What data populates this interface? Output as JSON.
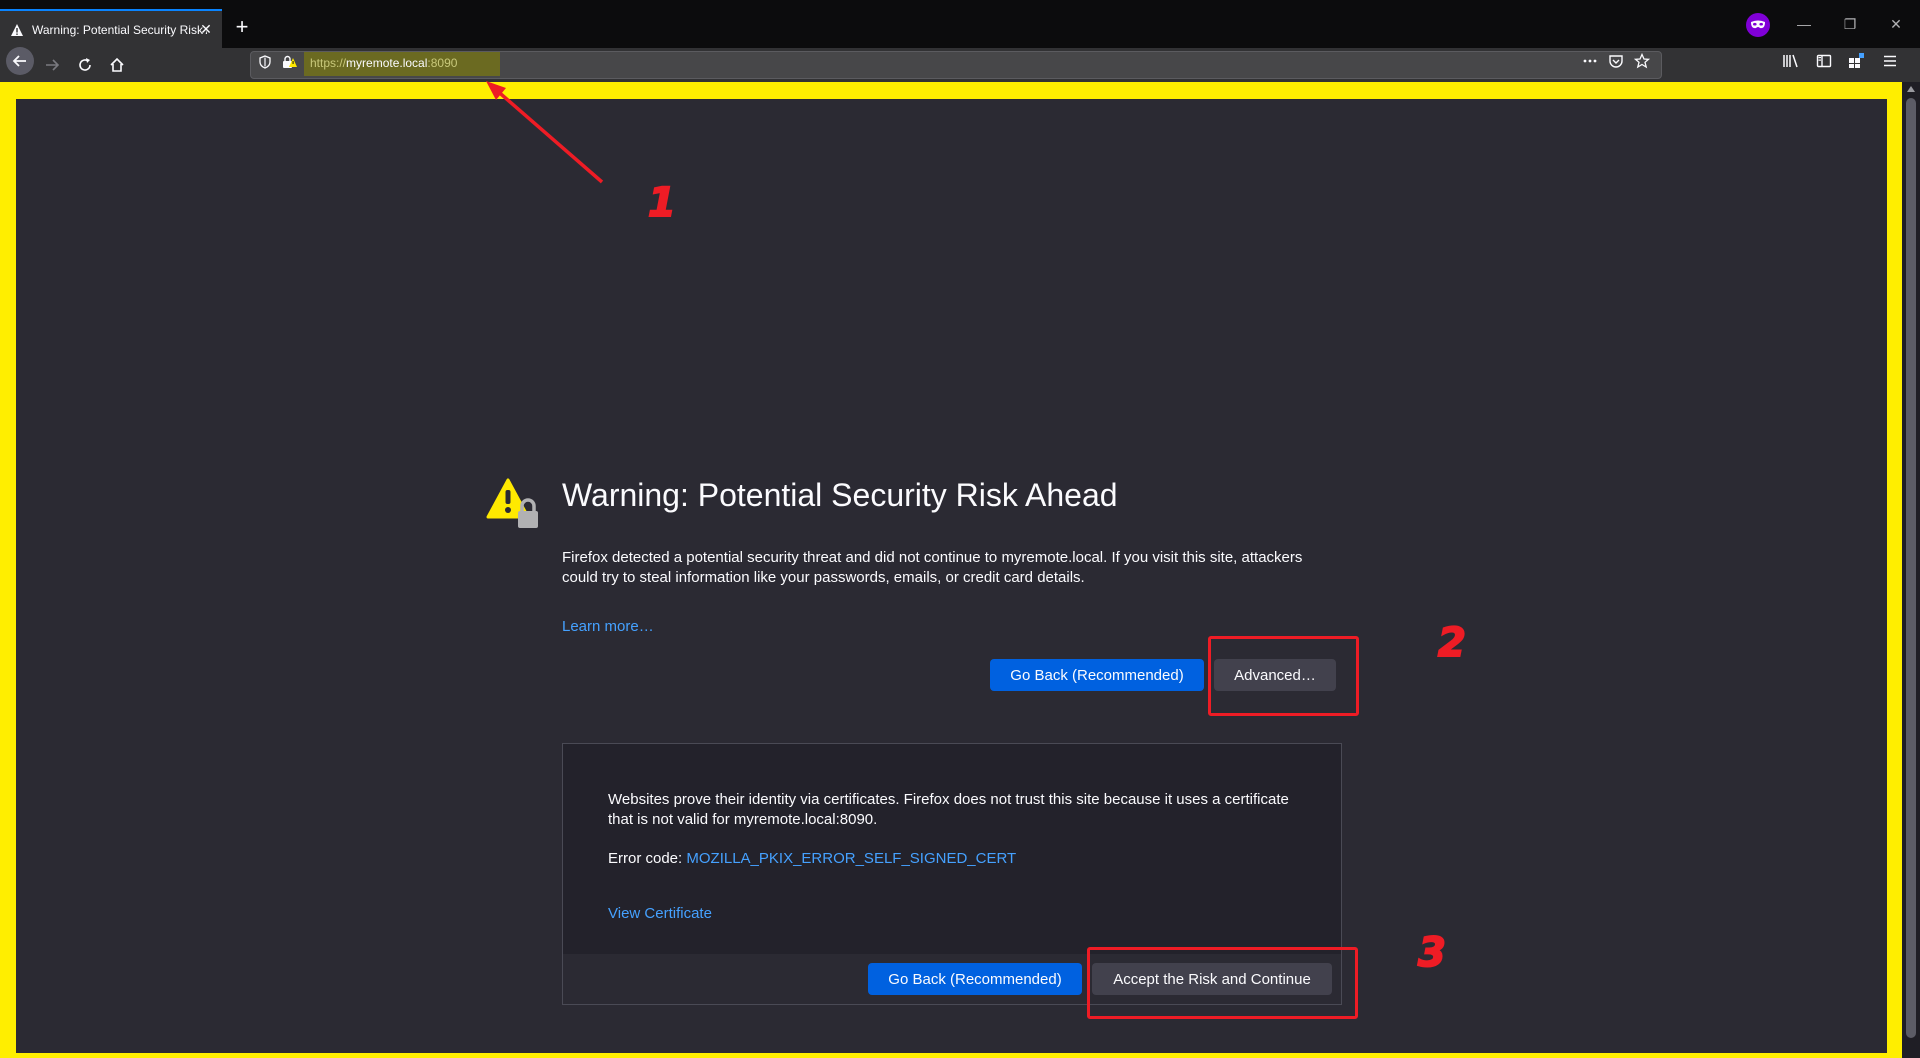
{
  "browser": {
    "tab": {
      "title": "Warning: Potential Security Risk Ahead",
      "close_glyph": "✕",
      "icon": "warning-icon"
    },
    "new_tab_glyph": "+",
    "window_controls": {
      "minimize": "—",
      "restore": "❐",
      "close": "✕"
    },
    "url": {
      "scheme": "https://",
      "host": "myremote.local",
      "port": ":8090"
    },
    "accent": "#0a84ff",
    "private_badge_color": "#8000d7"
  },
  "page": {
    "title": "Warning: Potential Security Risk Ahead",
    "description": "Firefox detected a potential security threat and did not continue to myremote.local. If you visit this site, attackers could try to steal information like your passwords, emails, or credit card details.",
    "learn_more": "Learn more…",
    "go_back_label": "Go Back (Recommended)",
    "advanced_label": "Advanced…",
    "advanced_panel": {
      "text": "Websites prove their identity via certificates. Firefox does not trust this site because it uses a certificate that is not valid for myremote.local:8090.",
      "error_label": "Error code: ",
      "error_code": "MOZILLA_PKIX_ERROR_SELF_SIGNED_CERT",
      "view_certificate": "View Certificate",
      "go_back_label": "Go Back (Recommended)",
      "accept_label": "Accept the Risk and Continue"
    }
  },
  "annotations": {
    "label_1": "1",
    "label_2": "2",
    "label_3": "3",
    "color": "#ee1c25",
    "frame_color": "#ffee00"
  }
}
